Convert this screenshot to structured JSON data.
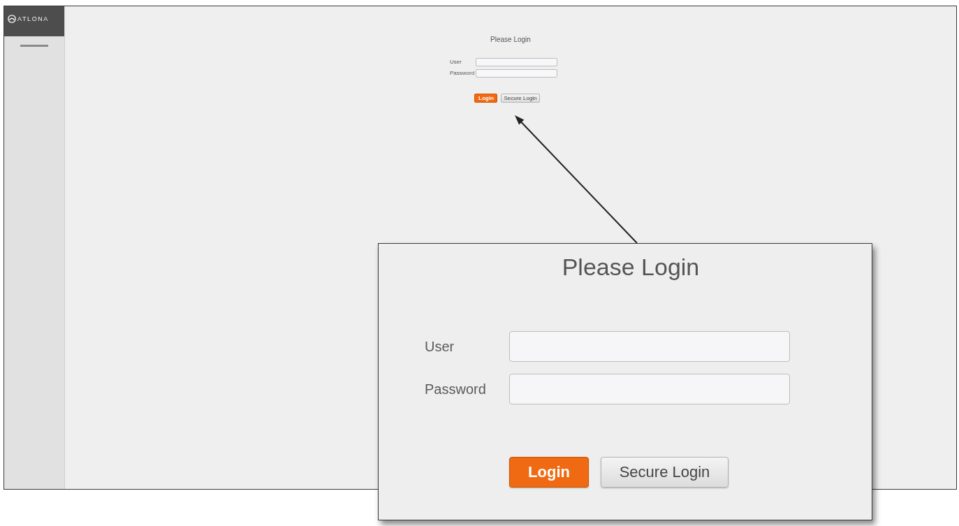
{
  "sidebar": {
    "logo_text": "ATLONA"
  },
  "login_form": {
    "title": "Please Login",
    "fields": [
      {
        "label": "User"
      },
      {
        "label": "Password"
      }
    ],
    "buttons": [
      {
        "label": "Login",
        "kind": "primary"
      },
      {
        "label": "Secure Login",
        "kind": "secondary"
      }
    ]
  },
  "zoom_callout": {
    "title": "Please Login",
    "fields": [
      {
        "label": "User"
      },
      {
        "label": "Password"
      }
    ],
    "buttons": [
      {
        "label": "Login",
        "kind": "primary"
      },
      {
        "label": "Secure Login",
        "kind": "secondary"
      }
    ]
  }
}
